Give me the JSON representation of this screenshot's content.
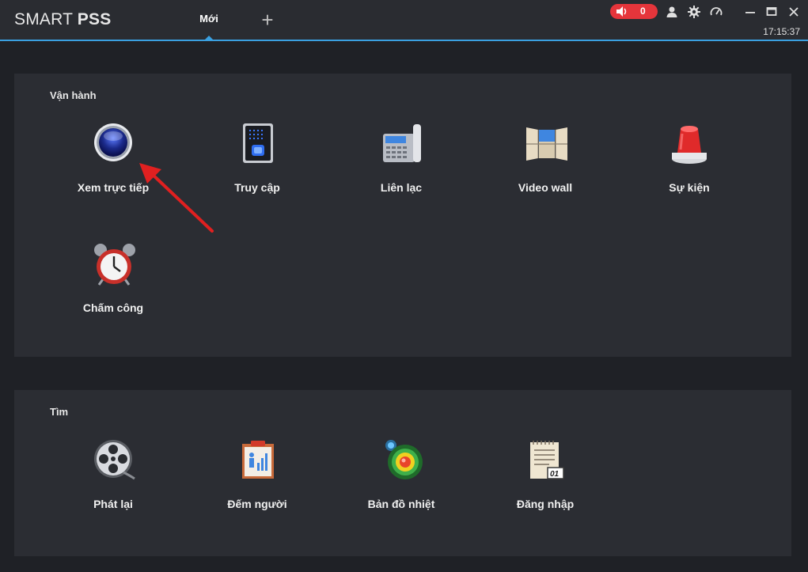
{
  "app": {
    "logo_thin": "SMART ",
    "logo_bold": "PSS",
    "tab_label": "Mới",
    "add_tab_symbol": "+",
    "alarm_count": "0",
    "time": "17:15:37",
    "icons": [
      "speaker-icon",
      "user-icon",
      "gear-icon",
      "speedometer-icon",
      "minimize-icon",
      "maximize-icon",
      "close-icon"
    ]
  },
  "sections": {
    "operation": {
      "title": "Vận hành",
      "items": [
        {
          "label": "Xem trực tiếp",
          "icon": "camera-lens-icon"
        },
        {
          "label": "Truy cập",
          "icon": "access-control-icon"
        },
        {
          "label": "Liên lạc",
          "icon": "phone-icon"
        },
        {
          "label": "Video wall",
          "icon": "video-wall-icon"
        },
        {
          "label": "Sự kiện",
          "icon": "alarm-light-icon"
        },
        {
          "label": "Chấm công",
          "icon": "alarm-clock-icon"
        }
      ]
    },
    "search": {
      "title": "Tìm",
      "items": [
        {
          "label": "Phát lại",
          "icon": "film-reel-icon"
        },
        {
          "label": "Đếm người",
          "icon": "people-count-icon"
        },
        {
          "label": "Bản đồ nhiệt",
          "icon": "heatmap-icon"
        },
        {
          "label": "Đăng nhập",
          "icon": "log-icon"
        }
      ]
    }
  },
  "colors": {
    "accent": "#3aa0e0",
    "alarm": "#e5353b",
    "annotation_arrow": "#e02020"
  }
}
